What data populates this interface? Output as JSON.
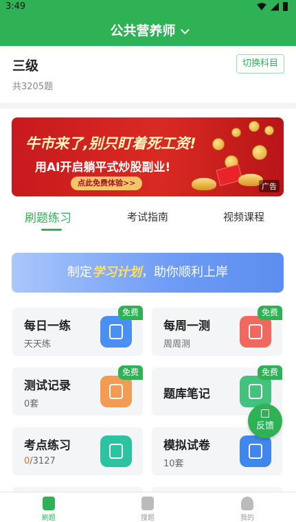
{
  "status_bar": {
    "time": "3:49"
  },
  "header": {
    "title": "公共营养师"
  },
  "level_card": {
    "level": "三级",
    "question_count": "共3205题",
    "switch_label": "切换科目"
  },
  "ad_banner": {
    "line1": "牛市来了,别只盯着死工资!",
    "line2": "用AI开启躺平式炒股副业!",
    "cta": "点此免费体验>>",
    "ad_tag": "广告"
  },
  "tabs": [
    {
      "label": "刷题练习",
      "active": true
    },
    {
      "label": "考试指南",
      "active": false
    },
    {
      "label": "视频课程",
      "active": false
    }
  ],
  "plan_banner": {
    "prefix": "制定",
    "highlight": "学习计划",
    "suffix": "，助你顺利上岸"
  },
  "cards": [
    {
      "title": "每日一练",
      "sub": "天天练",
      "icon": "calendar-icon",
      "badge": "免费"
    },
    {
      "title": "每周一测",
      "sub": "周周测",
      "icon": "chart-icon",
      "badge": "免费"
    },
    {
      "title": "测试记录",
      "sub": "0套",
      "icon": "document-icon",
      "badge": "免费"
    },
    {
      "title": "题库笔记",
      "sub": "",
      "icon": "notebook-icon",
      "badge": "免费"
    },
    {
      "title": "考点练习",
      "sub_done": "0",
      "sub_total": "/3127",
      "icon": "star-icon"
    },
    {
      "title": "模拟试卷",
      "sub": "10套",
      "icon": "presentation-icon"
    }
  ],
  "feedback": {
    "label": "反馈"
  },
  "bottom_nav": [
    {
      "label": "刷题",
      "active": true,
      "icon": "practice-icon"
    },
    {
      "label": "搜题",
      "active": false,
      "icon": "search-icon"
    },
    {
      "label": "我的",
      "active": false,
      "icon": "profile-icon"
    }
  ],
  "colors": {
    "brand_green": "#2fb255",
    "highlight_yellow": "#ffe259",
    "accent_orange": "#e8702a"
  }
}
